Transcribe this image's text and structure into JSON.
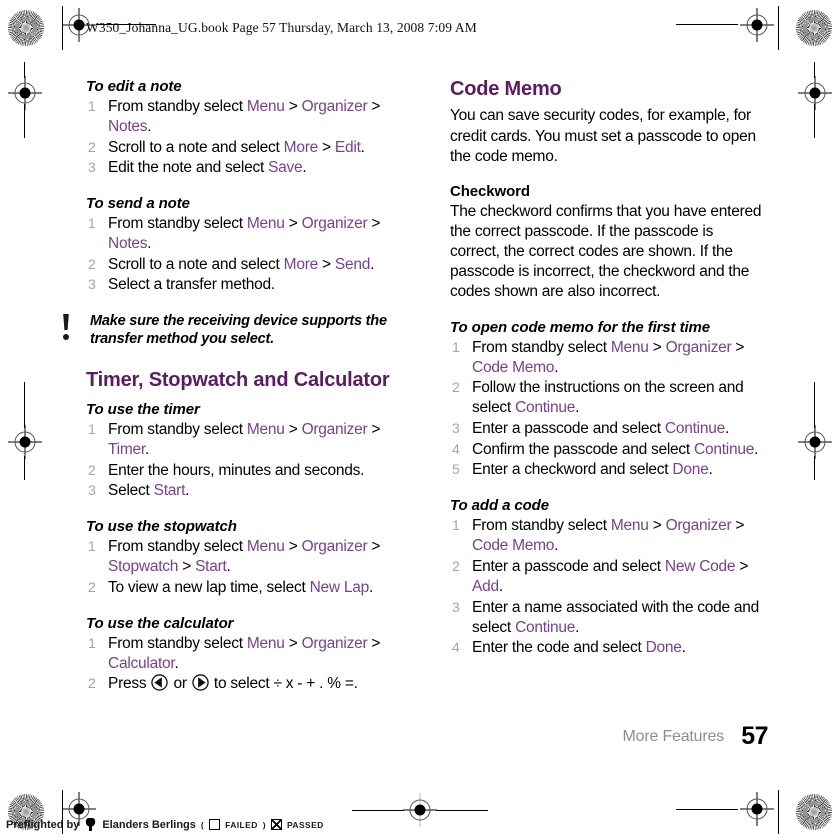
{
  "header": {
    "text": "W350_Johanna_UG.book  Page 57  Thursday, March 13, 2008  7:09 AM"
  },
  "colors": {
    "heading_purple": "#5c1b63",
    "link_purple": "#7b3f8f",
    "step_number_gray": "#a5a5a5",
    "footer_gray": "#8d8d8d"
  },
  "left_column": {
    "sections": [
      {
        "subheading": "To edit a note",
        "steps": [
          "From standby select Menu > Organizer > Notes.",
          "Scroll to a note and select More > Edit.",
          "Edit the note and select Save."
        ]
      },
      {
        "subheading": "To send a note",
        "steps": [
          "From standby select Menu > Organizer > Notes.",
          "Scroll to a note and select More > Send.",
          "Select a transfer method."
        ]
      }
    ],
    "tip": {
      "icon": "exclamation-icon",
      "text": "Make sure the receiving device supports the transfer method you select."
    },
    "heading": "Timer, Stopwatch and Calculator",
    "sections2": [
      {
        "subheading": "To use the timer",
        "steps": [
          "From standby select Menu > Organizer > Timer.",
          "Enter the hours, minutes and seconds.",
          "Select Start."
        ]
      },
      {
        "subheading": "To use the stopwatch",
        "steps": [
          "From standby select Menu > Organizer > Stopwatch > Start.",
          "To view a new lap time, select New Lap."
        ]
      },
      {
        "subheading": "To use the calculator",
        "steps": [
          "From standby select Menu > Organizer > Calculator.",
          "Press ◀ or ▶ to select ÷ x - + . % =."
        ]
      }
    ],
    "calculator_symbols": "÷ x - + . % =.",
    "nav_left_icon": "nav-key-left-icon",
    "nav_right_icon": "nav-key-right-icon"
  },
  "right_column": {
    "heading": "Code Memo",
    "intro": "You can save security codes, for example, for credit cards. You must set a passcode to open the code memo.",
    "checkword_heading": "Checkword",
    "checkword_body": "The checkword confirms that you have entered the correct passcode. If the passcode is correct, the correct codes are shown. If the passcode is incorrect, the checkword and the codes shown are also incorrect.",
    "sections": [
      {
        "subheading": "To open code memo for the first time",
        "steps": [
          "From standby select Menu > Organizer > Code Memo.",
          "Follow the instructions on the screen and select Continue.",
          "Enter a passcode and select Continue.",
          "Confirm the passcode and select Continue.",
          "Enter a checkword and select Done."
        ]
      },
      {
        "subheading": "To add a code",
        "steps": [
          "From standby select Menu > Organizer > Code Memo.",
          "Enter a passcode and select New Code > Add.",
          "Enter a name associated with the code and select Continue.",
          "Enter the code and select Done."
        ]
      }
    ]
  },
  "footer": {
    "chapter": "More Features",
    "page_number": "57"
  },
  "preflight": {
    "prefix": "Preflighted by",
    "company": "Elanders Berlings",
    "open_paren": "(",
    "failed_label": "FAILED",
    "close_paren": ")",
    "passed_label": "PASSED"
  }
}
